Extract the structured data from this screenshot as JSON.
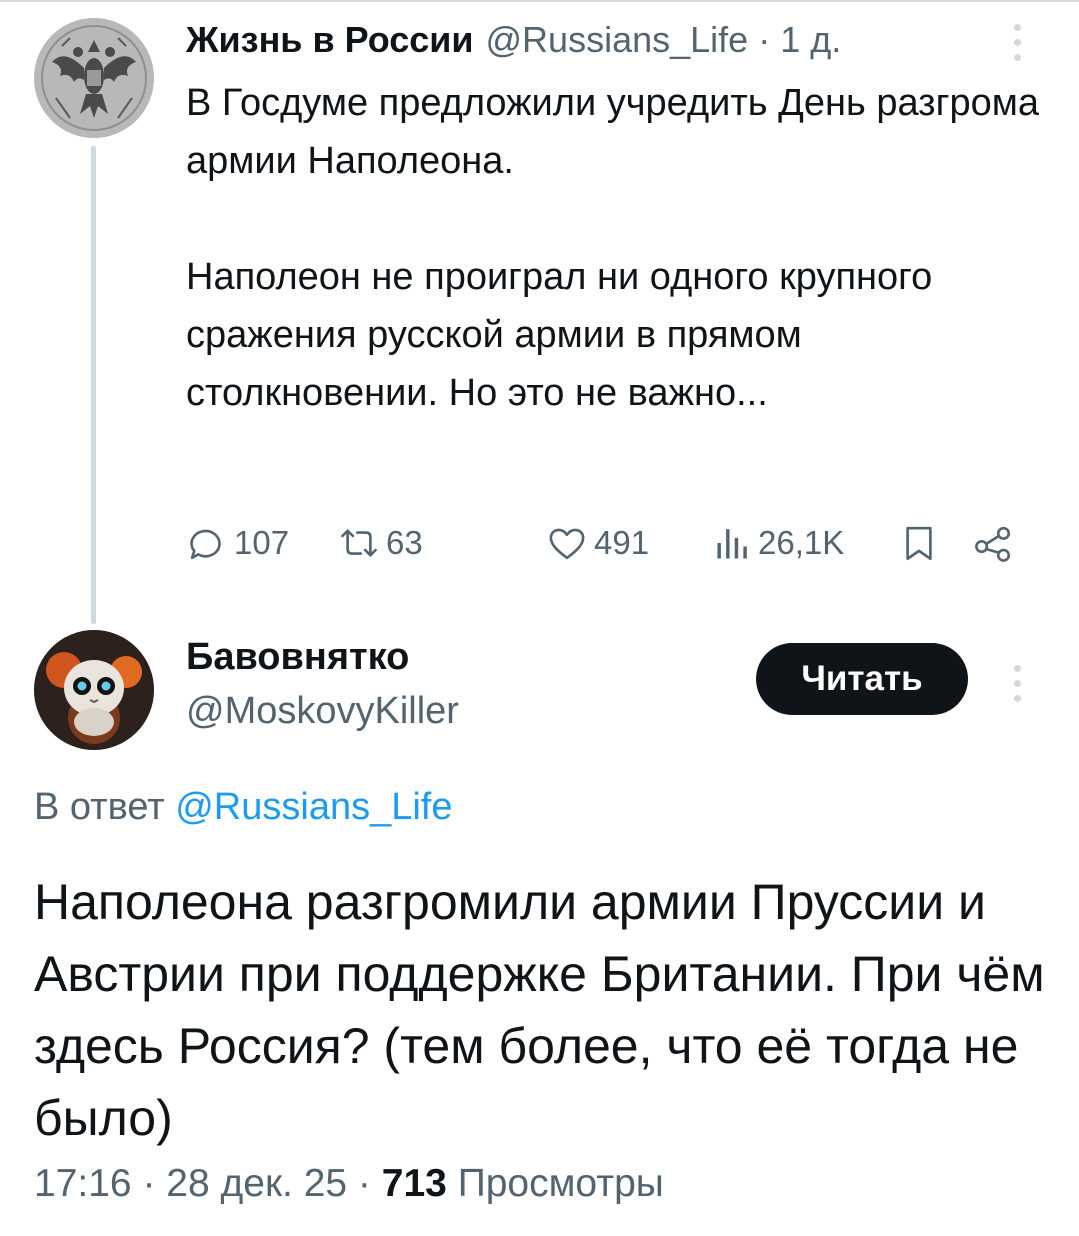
{
  "parent_tweet": {
    "author_name": "Жизнь в России",
    "handle": "@Russians_Life",
    "separator": "·",
    "time": "1 д.",
    "paragraphs": [
      "В Госдуме предложили учредить День разгрома армии Наполеона.",
      "Наполеон не проиграл ни одного крупного сражения русской армии в прямом столкновении. Но это не важно..."
    ],
    "stats": {
      "replies": "107",
      "reposts": "63",
      "likes": "491",
      "views": "26,1K"
    },
    "icons": [
      "reply-icon",
      "repost-icon",
      "like-icon",
      "views-icon",
      "bookmark-icon",
      "share-icon",
      "more-icon"
    ]
  },
  "reply_tweet": {
    "author_name": "Бавовнятко",
    "handle": "@MoskovyKiller",
    "follow_label": "Читать",
    "reply_to_prefix": "В ответ",
    "reply_to_mention": "@Russians_Life",
    "text": "Наполеона разгромили армии Пруссии и Австрии при поддержке Британии. При чём здесь Россия? (тем более, что её тогда не было)",
    "time": "17:16",
    "date": "28 дек. 25",
    "separator": "·",
    "views_count": "713",
    "views_label": "Просмотры"
  },
  "colors": {
    "text_primary": "#0f1419",
    "text_secondary": "#536471",
    "link": "#1d9bf0",
    "follow_button": "#0f1419",
    "thread_line": "#cfd9de"
  }
}
